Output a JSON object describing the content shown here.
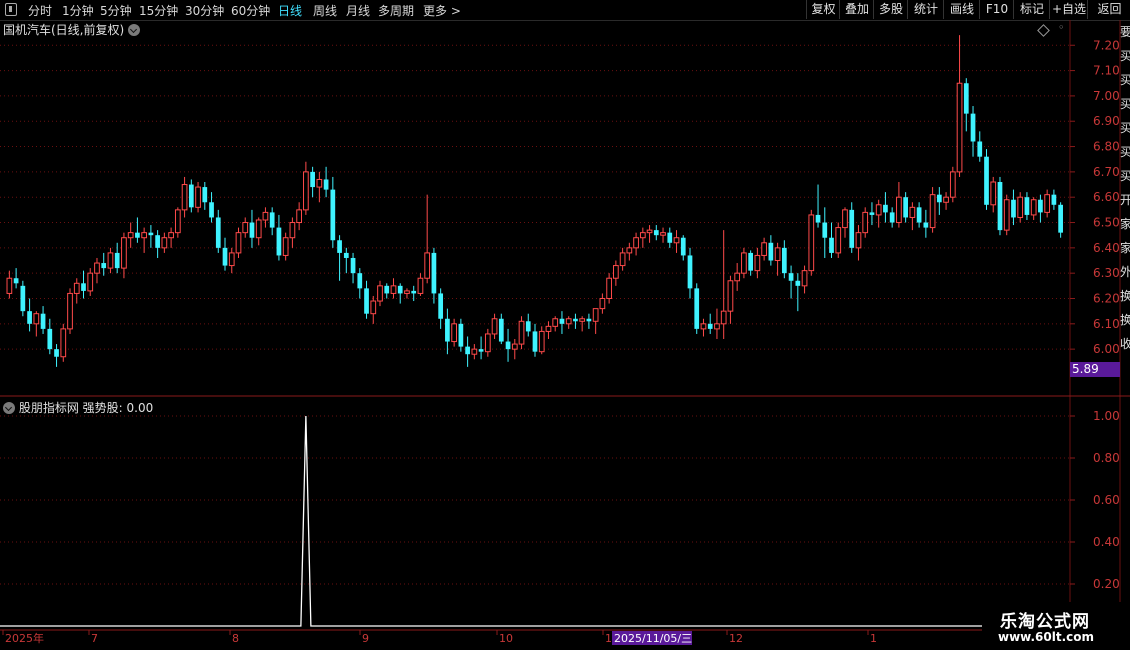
{
  "toolbar": {
    "periods": [
      "分时",
      "1分钟",
      "5分钟",
      "15分钟",
      "30分钟",
      "60分钟",
      "日线",
      "周线",
      "月线",
      "多周期",
      "更多 >"
    ],
    "active_period": "日线",
    "right_buttons": [
      "复权",
      "叠加",
      "多股",
      "统计",
      "画线",
      "F10",
      "标记",
      "+自选",
      "返回"
    ]
  },
  "main_panel": {
    "title": "国机汽车(日线,前复权)",
    "price_tag": "5.89",
    "price_tag_color": "#5a1a9a"
  },
  "indicator_panel": {
    "title": "股朋指标网 强势股: 0.00"
  },
  "xaxis": {
    "labels": [
      "2025年",
      "7",
      "8",
      "9",
      "10",
      "1",
      "2025/11/05/三",
      "12",
      "1"
    ],
    "cursor_label_color": "#5a1a9a"
  },
  "side_chars": [
    "要",
    "买",
    "买",
    "买",
    "买",
    "买",
    "买",
    "开",
    "家",
    "家",
    "外",
    "换",
    "换",
    "收"
  ],
  "watermark": {
    "line1": "乐淘公式网",
    "line2": "www.60lt.com"
  },
  "colors": {
    "up": "#ff4a4a",
    "down": "#3ff3ff",
    "grid": "#6a1010",
    "axis_text": "#c83838",
    "line": "#ffffff"
  },
  "chart_data": [
    {
      "type": "candlestick",
      "title": "国机汽车(日线,前复权)",
      "ylim": [
        5.89,
        7.28
      ],
      "yticks": [
        6.0,
        6.1,
        6.2,
        6.3,
        6.4,
        6.5,
        6.6,
        6.7,
        6.8,
        6.9,
        7.0,
        7.1,
        7.2
      ],
      "ohlc": [
        [
          6.22,
          6.31,
          6.2,
          6.28
        ],
        [
          6.28,
          6.32,
          6.24,
          6.26
        ],
        [
          6.25,
          6.27,
          6.13,
          6.15
        ],
        [
          6.15,
          6.2,
          6.07,
          6.1
        ],
        [
          6.1,
          6.15,
          6.05,
          6.14
        ],
        [
          6.14,
          6.17,
          6.06,
          6.08
        ],
        [
          6.08,
          6.12,
          5.98,
          6.0
        ],
        [
          6.0,
          6.02,
          5.93,
          5.97
        ],
        [
          5.97,
          6.1,
          5.95,
          6.08
        ],
        [
          6.08,
          6.24,
          6.06,
          6.22
        ],
        [
          6.22,
          6.28,
          6.18,
          6.26
        ],
        [
          6.26,
          6.31,
          6.2,
          6.23
        ],
        [
          6.23,
          6.32,
          6.21,
          6.3
        ],
        [
          6.3,
          6.36,
          6.26,
          6.34
        ],
        [
          6.34,
          6.38,
          6.29,
          6.32
        ],
        [
          6.32,
          6.4,
          6.3,
          6.38
        ],
        [
          6.38,
          6.42,
          6.3,
          6.32
        ],
        [
          6.32,
          6.46,
          6.28,
          6.44
        ],
        [
          6.44,
          6.5,
          6.4,
          6.46
        ],
        [
          6.46,
          6.52,
          6.42,
          6.44
        ],
        [
          6.44,
          6.48,
          6.38,
          6.46
        ],
        [
          6.46,
          6.49,
          6.4,
          6.45
        ],
        [
          6.45,
          6.47,
          6.36,
          6.4
        ],
        [
          6.4,
          6.46,
          6.38,
          6.44
        ],
        [
          6.44,
          6.48,
          6.4,
          6.46
        ],
        [
          6.46,
          6.56,
          6.44,
          6.55
        ],
        [
          6.55,
          6.68,
          6.52,
          6.65
        ],
        [
          6.65,
          6.67,
          6.54,
          6.56
        ],
        [
          6.56,
          6.66,
          6.54,
          6.64
        ],
        [
          6.64,
          6.66,
          6.55,
          6.58
        ],
        [
          6.58,
          6.62,
          6.5,
          6.52
        ],
        [
          6.52,
          6.55,
          6.38,
          6.4
        ],
        [
          6.4,
          6.44,
          6.31,
          6.33
        ],
        [
          6.33,
          6.4,
          6.3,
          6.38
        ],
        [
          6.38,
          6.48,
          6.36,
          6.46
        ],
        [
          6.46,
          6.52,
          6.44,
          6.5
        ],
        [
          6.5,
          6.55,
          6.4,
          6.44
        ],
        [
          6.44,
          6.52,
          6.41,
          6.51
        ],
        [
          6.51,
          6.56,
          6.48,
          6.54
        ],
        [
          6.54,
          6.56,
          6.45,
          6.48
        ],
        [
          6.48,
          6.53,
          6.35,
          6.37
        ],
        [
          6.37,
          6.46,
          6.35,
          6.44
        ],
        [
          6.44,
          6.52,
          6.4,
          6.5
        ],
        [
          6.5,
          6.58,
          6.47,
          6.55
        ],
        [
          6.55,
          6.74,
          6.53,
          6.7
        ],
        [
          6.7,
          6.72,
          6.6,
          6.64
        ],
        [
          6.64,
          6.7,
          6.58,
          6.67
        ],
        [
          6.67,
          6.72,
          6.6,
          6.63
        ],
        [
          6.63,
          6.68,
          6.4,
          6.43
        ],
        [
          6.43,
          6.45,
          6.27,
          6.38
        ],
        [
          6.38,
          6.4,
          6.3,
          6.36
        ],
        [
          6.36,
          6.38,
          6.26,
          6.3
        ],
        [
          6.3,
          6.32,
          6.2,
          6.24
        ],
        [
          6.24,
          6.27,
          6.12,
          6.14
        ],
        [
          6.14,
          6.21,
          6.1,
          6.19
        ],
        [
          6.19,
          6.27,
          6.17,
          6.25
        ],
        [
          6.25,
          6.26,
          6.2,
          6.22
        ],
        [
          6.22,
          6.28,
          6.2,
          6.25
        ],
        [
          6.25,
          6.26,
          6.18,
          6.22
        ],
        [
          6.22,
          6.24,
          6.2,
          6.23
        ],
        [
          6.23,
          6.25,
          6.19,
          6.22
        ],
        [
          6.22,
          6.3,
          6.21,
          6.28
        ],
        [
          6.28,
          6.61,
          6.26,
          6.38
        ],
        [
          6.38,
          6.4,
          6.18,
          6.22
        ],
        [
          6.22,
          6.24,
          6.08,
          6.12
        ],
        [
          6.12,
          6.16,
          5.98,
          6.03
        ],
        [
          6.03,
          6.12,
          6.01,
          6.1
        ],
        [
          6.1,
          6.12,
          5.99,
          6.01
        ],
        [
          6.01,
          6.05,
          5.93,
          5.98
        ],
        [
          5.98,
          6.02,
          5.96,
          6.0
        ],
        [
          6.0,
          6.05,
          5.96,
          5.99
        ],
        [
          5.99,
          6.08,
          5.97,
          6.06
        ],
        [
          6.06,
          6.14,
          6.04,
          6.12
        ],
        [
          6.12,
          6.14,
          6.02,
          6.03
        ],
        [
          6.03,
          6.08,
          5.95,
          6.0
        ],
        [
          6.0,
          6.04,
          5.96,
          6.02
        ],
        [
          6.02,
          6.13,
          6.0,
          6.11
        ],
        [
          6.11,
          6.14,
          6.05,
          6.07
        ],
        [
          6.07,
          6.1,
          5.97,
          5.99
        ],
        [
          5.99,
          6.09,
          5.98,
          6.07
        ],
        [
          6.07,
          6.11,
          6.04,
          6.09
        ],
        [
          6.09,
          6.13,
          6.07,
          6.12
        ],
        [
          6.12,
          6.15,
          6.06,
          6.1
        ],
        [
          6.1,
          6.13,
          6.08,
          6.12
        ],
        [
          6.12,
          6.14,
          6.08,
          6.11
        ],
        [
          6.11,
          6.13,
          6.07,
          6.12
        ],
        [
          6.12,
          6.14,
          6.08,
          6.11
        ],
        [
          6.11,
          6.15,
          6.06,
          6.16
        ],
        [
          6.16,
          6.22,
          6.14,
          6.2
        ],
        [
          6.2,
          6.3,
          6.18,
          6.28
        ],
        [
          6.28,
          6.35,
          6.25,
          6.33
        ],
        [
          6.33,
          6.4,
          6.31,
          6.38
        ],
        [
          6.38,
          6.42,
          6.35,
          6.4
        ],
        [
          6.4,
          6.46,
          6.37,
          6.44
        ],
        [
          6.44,
          6.48,
          6.4,
          6.46
        ],
        [
          6.46,
          6.49,
          6.42,
          6.47
        ],
        [
          6.47,
          6.49,
          6.43,
          6.45
        ],
        [
          6.45,
          6.48,
          6.42,
          6.46
        ],
        [
          6.46,
          6.48,
          6.4,
          6.42
        ],
        [
          6.42,
          6.47,
          6.38,
          6.44
        ],
        [
          6.44,
          6.45,
          6.35,
          6.37
        ],
        [
          6.37,
          6.4,
          6.2,
          6.24
        ],
        [
          6.24,
          6.26,
          6.06,
          6.08
        ],
        [
          6.08,
          6.12,
          6.05,
          6.1
        ],
        [
          6.1,
          6.14,
          6.06,
          6.08
        ],
        [
          6.08,
          6.16,
          6.04,
          6.1
        ],
        [
          6.1,
          6.47,
          6.04,
          6.15
        ],
        [
          6.15,
          6.29,
          6.1,
          6.27
        ],
        [
          6.27,
          6.34,
          6.23,
          6.3
        ],
        [
          6.3,
          6.4,
          6.28,
          6.38
        ],
        [
          6.38,
          6.39,
          6.29,
          6.31
        ],
        [
          6.31,
          6.4,
          6.28,
          6.37
        ],
        [
          6.37,
          6.44,
          6.35,
          6.42
        ],
        [
          6.42,
          6.45,
          6.33,
          6.35
        ],
        [
          6.35,
          6.42,
          6.29,
          6.4
        ],
        [
          6.4,
          6.43,
          6.28,
          6.3
        ],
        [
          6.3,
          6.33,
          6.2,
          6.27
        ],
        [
          6.27,
          6.3,
          6.15,
          6.25
        ],
        [
          6.25,
          6.33,
          6.22,
          6.31
        ],
        [
          6.31,
          6.55,
          6.29,
          6.53
        ],
        [
          6.53,
          6.65,
          6.48,
          6.5
        ],
        [
          6.5,
          6.56,
          6.36,
          6.44
        ],
        [
          6.44,
          6.5,
          6.36,
          6.38
        ],
        [
          6.38,
          6.5,
          6.36,
          6.48
        ],
        [
          6.48,
          6.56,
          6.44,
          6.55
        ],
        [
          6.55,
          6.58,
          6.38,
          6.4
        ],
        [
          6.4,
          6.49,
          6.35,
          6.46
        ],
        [
          6.46,
          6.56,
          6.44,
          6.54
        ],
        [
          6.54,
          6.58,
          6.49,
          6.53
        ],
        [
          6.53,
          6.59,
          6.48,
          6.57
        ],
        [
          6.57,
          6.62,
          6.5,
          6.54
        ],
        [
          6.54,
          6.56,
          6.48,
          6.5
        ],
        [
          6.5,
          6.66,
          6.48,
          6.6
        ],
        [
          6.6,
          6.62,
          6.5,
          6.52
        ],
        [
          6.52,
          6.58,
          6.47,
          6.56
        ],
        [
          6.56,
          6.58,
          6.48,
          6.5
        ],
        [
          6.5,
          6.55,
          6.44,
          6.48
        ],
        [
          6.48,
          6.64,
          6.46,
          6.61
        ],
        [
          6.61,
          6.64,
          6.53,
          6.58
        ],
        [
          6.58,
          6.62,
          6.55,
          6.6
        ],
        [
          6.6,
          6.72,
          6.58,
          6.7
        ],
        [
          6.7,
          7.24,
          6.68,
          7.05
        ],
        [
          7.05,
          7.07,
          6.86,
          6.93
        ],
        [
          6.93,
          6.96,
          6.76,
          6.82
        ],
        [
          6.82,
          6.86,
          6.74,
          6.76
        ],
        [
          6.76,
          6.79,
          6.55,
          6.57
        ],
        [
          6.57,
          6.68,
          6.54,
          6.66
        ],
        [
          6.66,
          6.68,
          6.45,
          6.47
        ],
        [
          6.47,
          6.61,
          6.45,
          6.59
        ],
        [
          6.59,
          6.63,
          6.49,
          6.52
        ],
        [
          6.52,
          6.62,
          6.5,
          6.6
        ],
        [
          6.6,
          6.62,
          6.51,
          6.53
        ],
        [
          6.53,
          6.6,
          6.51,
          6.59
        ],
        [
          6.59,
          6.61,
          6.5,
          6.54
        ],
        [
          6.54,
          6.63,
          6.52,
          6.61
        ],
        [
          6.61,
          6.63,
          6.55,
          6.57
        ],
        [
          6.57,
          6.58,
          6.44,
          6.46
        ]
      ]
    },
    {
      "type": "line",
      "title": "股朋指标网 强势股: 0.00",
      "series": [
        {
          "name": "强势股",
          "spike_at_index": 44
        }
      ],
      "ylim": [
        0,
        1.0
      ],
      "yticks": [
        0.2,
        0.4,
        0.6,
        0.8,
        1.0
      ]
    }
  ]
}
